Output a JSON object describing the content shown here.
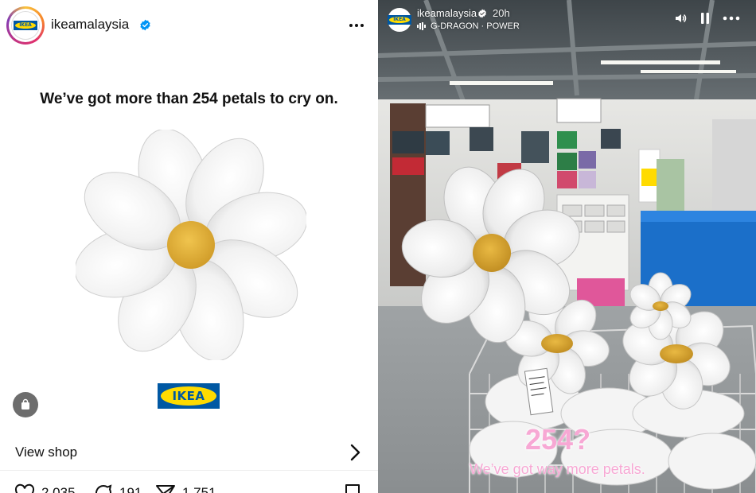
{
  "post": {
    "username": "ikeamalaysia",
    "verified_icon": "verified-badge-icon",
    "avatar_logo_text": "IKEA",
    "more_icon": "more-horizontal-icon",
    "headline": "We’ve got more than 254 petals to cry on.",
    "brand_logo_text": "IKEA",
    "shop_icon": "shopping-bag-icon",
    "view_shop_label": "View shop",
    "chevron_icon": "chevron-right-icon",
    "actions": {
      "likes": "2,035",
      "comments": "191",
      "shares": "1,751"
    },
    "colors": {
      "ikea_blue": "#0058a3",
      "ikea_yellow": "#ffdb00",
      "verified_blue": "#0095f6"
    }
  },
  "story": {
    "username": "ikeamalaysia",
    "time_ago": "20h",
    "music": "G-DRAGON · POWER",
    "controls": [
      "volume-icon",
      "pause-icon",
      "more-horizontal-icon"
    ],
    "overlay_number": "254?",
    "overlay_text": "We’ve got way more petals.",
    "overlay_color": "#f7a8d4"
  }
}
